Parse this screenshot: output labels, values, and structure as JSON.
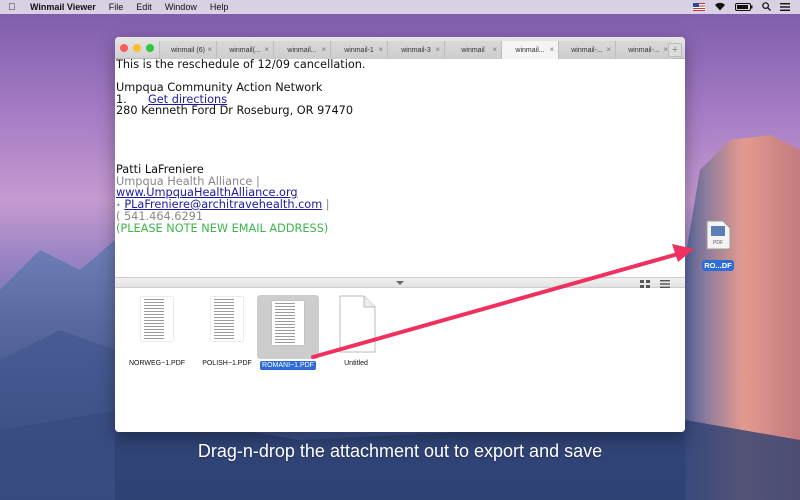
{
  "menubar": {
    "app_name": "Winmail Viewer",
    "items": [
      "File",
      "Edit",
      "Window",
      "Help"
    ]
  },
  "tabs": [
    {
      "label": "winmail (6)",
      "active": false
    },
    {
      "label": "winmail(...",
      "active": false
    },
    {
      "label": "winmail...",
      "active": false
    },
    {
      "label": "winmail-1",
      "active": false
    },
    {
      "label": "winmail-3",
      "active": false
    },
    {
      "label": "winmail",
      "active": false
    },
    {
      "label": "winmail...",
      "active": true
    },
    {
      "label": "winmail-...",
      "active": false
    },
    {
      "label": "winmail-...",
      "active": false
    }
  ],
  "email": {
    "line1": "This is the reschedule of 12/09 cancellation.",
    "org": "Umpqua Community Action Network",
    "list_number": "1.",
    "directions_link": "Get directions",
    "address": "280 Kenneth Ford Dr Roseburg, OR 97470",
    "sender_name": "Patti LaFreniere",
    "sender_org": "Umpqua Health Alliance  |",
    "website": "www.UmpquaHealthAlliance.org",
    "email_prefix": "•",
    "email_address": "PLaFreniere@architravehealth.com",
    "email_suffix": " |",
    "phone": "( 541.464.6291",
    "notice": "(PLEASE NOTE NEW EMAIL ADDRESS)"
  },
  "attachments": [
    {
      "name": "NORWEG~1.PDF",
      "selected": false
    },
    {
      "name": "POLISH~1.PDF",
      "selected": false
    },
    {
      "name": "ROMANI~1.PDF",
      "selected": true
    },
    {
      "name": "Untitled",
      "selected": false
    }
  ],
  "desktop_file": {
    "label": "RO...DF",
    "type_text": "PDF"
  },
  "caption": "Drag-n-drop the attachment out to export and save",
  "colors": {
    "arrow": "#f0305e",
    "selection": "#2d6bd7",
    "link": "#1a1aa6",
    "notice": "#3cb64b"
  }
}
